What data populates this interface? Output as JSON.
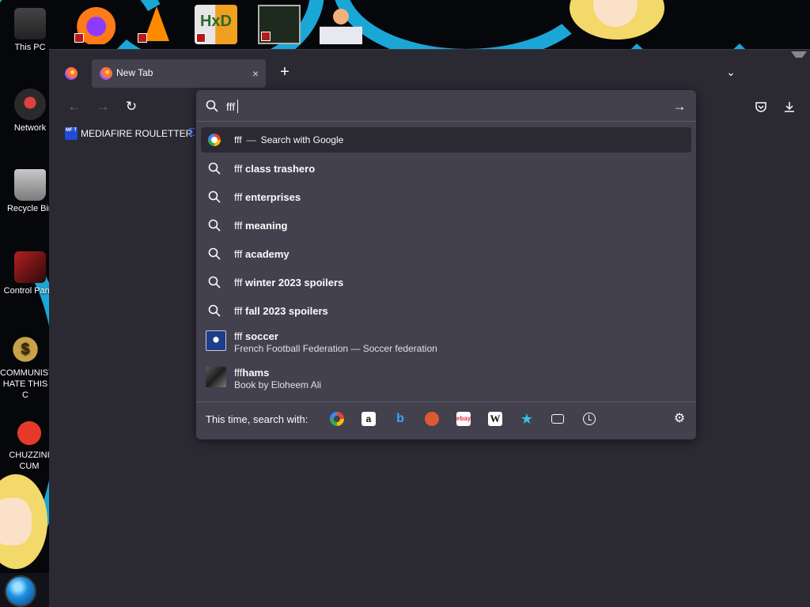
{
  "desktop": {
    "icons": [
      {
        "label": "This PC"
      },
      {
        "label": "Network"
      },
      {
        "label": "Recycle Bin"
      },
      {
        "label": "Control Panel"
      },
      {
        "label": "COMMUNIST HATE THIS C"
      },
      {
        "label": "CHUZZINI CUM"
      }
    ]
  },
  "browser": {
    "tab": {
      "title": "New Tab",
      "close_glyph": "×"
    },
    "new_tab_glyph": "+",
    "tab_list_glyph": "⌄",
    "nav": {
      "back_glyph": "←",
      "forward_glyph": "→",
      "reload_glyph": "↻"
    },
    "bookmarks": [
      {
        "label": "MEDIAFIRE ROULETTER",
        "icon_text": "MF T"
      }
    ]
  },
  "urlbar": {
    "query": "fff",
    "go_glyph": "→",
    "results": [
      {
        "type": "search-engine",
        "prefix": "fff",
        "separator": "—",
        "suffix": "Search with Google",
        "icon": "google-icon"
      },
      {
        "type": "suggestion",
        "prefix": "fff",
        "bold": "class trashero",
        "icon": "search-icon"
      },
      {
        "type": "suggestion",
        "prefix": "fff",
        "bold": "enterprises",
        "icon": "search-icon"
      },
      {
        "type": "suggestion",
        "prefix": "fff",
        "bold": "meaning",
        "icon": "search-icon"
      },
      {
        "type": "suggestion",
        "prefix": "fff",
        "bold": "academy",
        "icon": "search-icon"
      },
      {
        "type": "suggestion",
        "prefix": "fff",
        "bold": "winter 2023 spoilers",
        "icon": "search-icon"
      },
      {
        "type": "suggestion",
        "prefix": "fff",
        "bold": "fall 2023 spoilers",
        "icon": "search-icon"
      },
      {
        "type": "rich",
        "prefix": "fff",
        "bold": "soccer",
        "desc": "French Football Federation — Soccer federation"
      },
      {
        "type": "rich",
        "prefix": "fff",
        "bold": "hams",
        "desc": "Book by Eloheem Ali"
      }
    ],
    "one_off": {
      "label": "This time, search with:",
      "engines": [
        "google-icon",
        "amazon-icon",
        "bing-icon",
        "duckduckgo-icon",
        "ebay-icon",
        "wikipedia-icon",
        "bookmarks-icon",
        "tabs-icon",
        "history-icon"
      ],
      "amazon_text": "a",
      "bing_text": "b",
      "ebay_text": "ebay",
      "wiki_text": "W",
      "bookmarks_glyph": "★",
      "settings_glyph": "⚙"
    }
  },
  "colors": {
    "accent": "#1aa7d6",
    "panel": "#42414d",
    "toolbar": "#2b2a33"
  }
}
